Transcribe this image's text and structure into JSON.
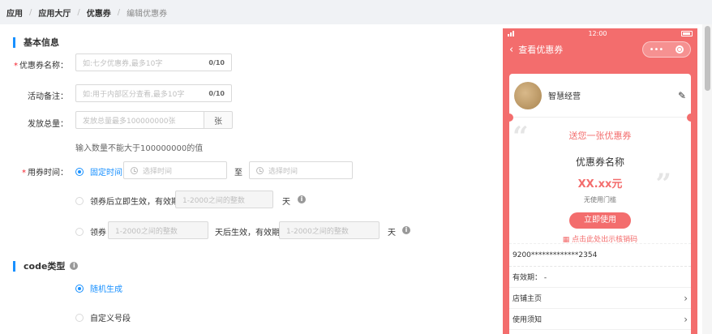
{
  "breadcrumb": [
    "应用",
    "应用大厅",
    "优惠券",
    "编辑优惠券"
  ],
  "basic_section": {
    "title": "基本信息"
  },
  "fields": {
    "coupon_name": {
      "label": "优惠券名称：",
      "placeholder": "如:七夕优惠券,最多10字",
      "count": "0/10"
    },
    "remark": {
      "label": "活动备注：",
      "placeholder": "如:用于内部区分查看,最多10字",
      "count": "0/10"
    },
    "total": {
      "label": "发放总量：",
      "placeholder": "发放总量最多100000000张",
      "unit": "张",
      "hint": "输入数量不能大于100000000的值"
    },
    "use_time": {
      "label": "用券时间：",
      "options": {
        "fixed": "固定时间",
        "start_placeholder": "选择时间",
        "to": "至",
        "end_placeholder": "选择时间",
        "after_receive": "领券后立即生效，有效期",
        "days_placeholder": "1-2000之间的整数",
        "day_unit": "天",
        "receive": "领券",
        "delay_placeholder": "1-2000之间的整数",
        "after_days": "天后生效，有效期",
        "valid_placeholder": "1-2000之间的整数",
        "day_unit2": "天"
      }
    }
  },
  "code_section": {
    "title": "code类型",
    "options": [
      "随机生成",
      "自定义号段"
    ]
  },
  "phone": {
    "time": "12:00",
    "nav_title": "查看优惠券",
    "capsule_dots": "•••",
    "shop_name": "智慧经营",
    "gift_text": "送您一张优惠券",
    "coupon_name": "优惠券名称",
    "price": "XX.xx元",
    "threshold": "无使用门槛",
    "use_button": "立即使用",
    "code_link": "点击此处出示核销码",
    "code": "9200*************2354",
    "validity": "有效期：  -",
    "rows": [
      "店铺主页",
      "使用须知"
    ]
  },
  "colors": {
    "accent": "#1890ff",
    "phone_theme": "#f36d6d",
    "required": "#f5222d"
  }
}
